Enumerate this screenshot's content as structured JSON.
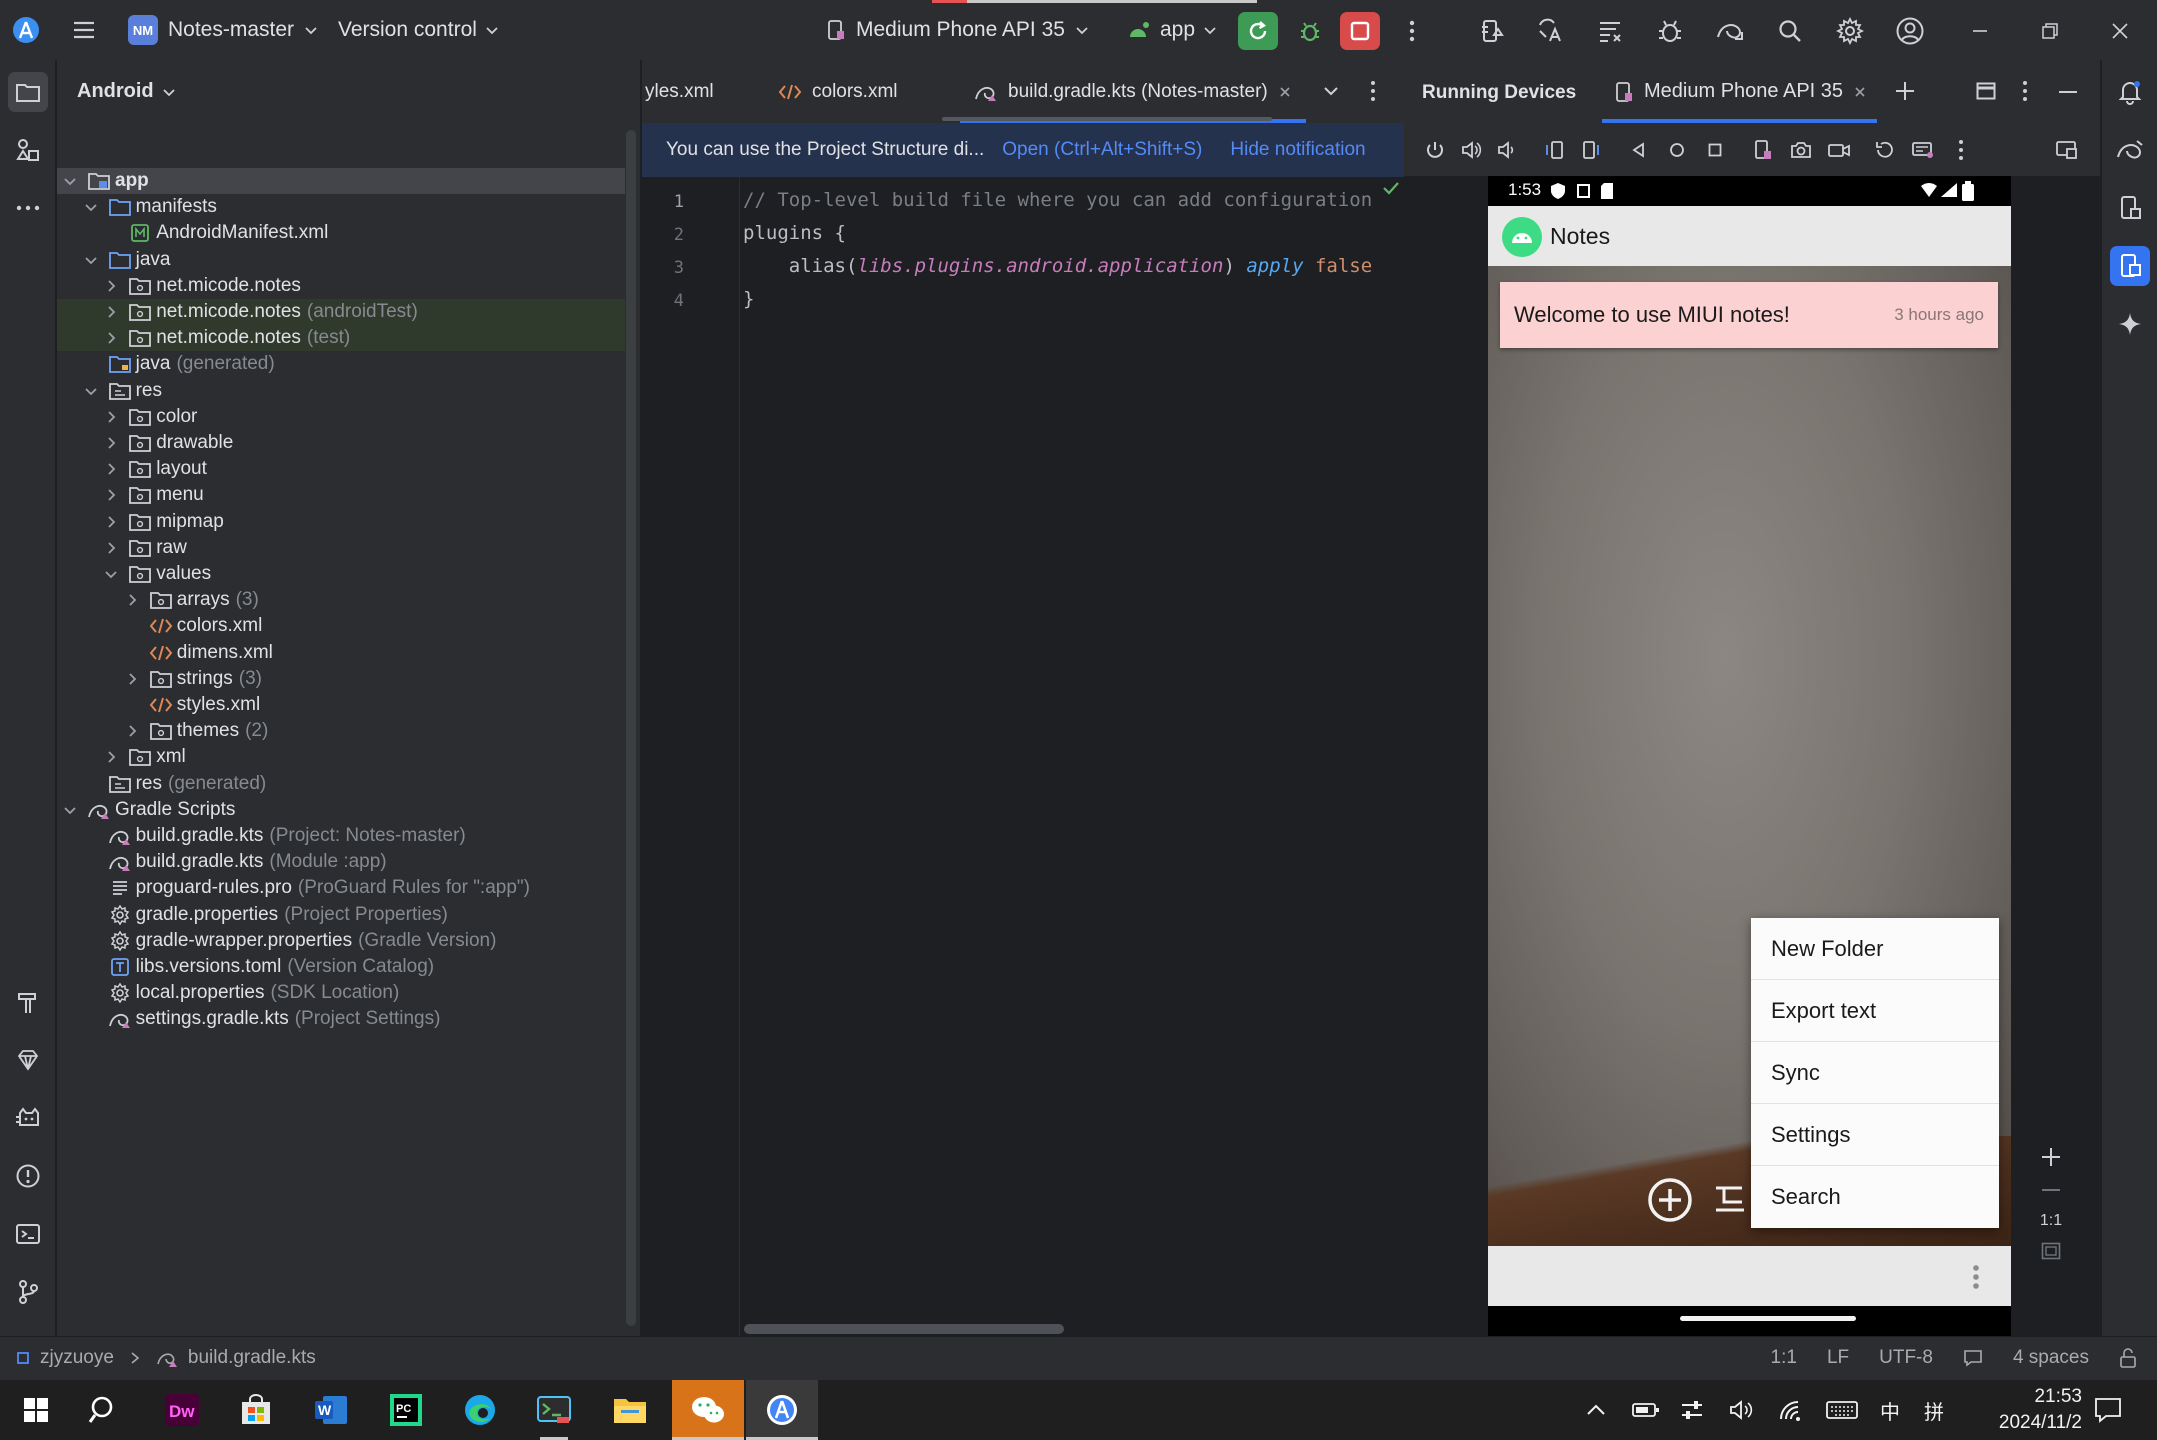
{
  "titlebar": {
    "project_badge": "NM",
    "project_name": "Notes-master",
    "vcs": "Version control",
    "device": "Medium Phone API 35",
    "run_config": "app"
  },
  "project_panel": {
    "view": "Android",
    "tree": [
      {
        "label": "app",
        "muted": "",
        "depth": 0,
        "chev": "down",
        "icon": "module-folder",
        "selected": true,
        "bold": true
      },
      {
        "label": "manifests",
        "muted": "",
        "depth": 1,
        "chev": "down",
        "icon": "folder"
      },
      {
        "label": "AndroidManifest.xml",
        "muted": "",
        "depth": 2,
        "chev": "none",
        "icon": "manifest"
      },
      {
        "label": "java",
        "muted": "",
        "depth": 1,
        "chev": "down",
        "icon": "folder"
      },
      {
        "label": "net.micode.notes",
        "muted": "",
        "depth": 2,
        "chev": "right",
        "icon": "package"
      },
      {
        "label": "net.micode.notes",
        "muted": "(androidTest)",
        "depth": 2,
        "chev": "right",
        "icon": "package",
        "test": true
      },
      {
        "label": "net.micode.notes",
        "muted": "(test)",
        "depth": 2,
        "chev": "right",
        "icon": "package",
        "test": true
      },
      {
        "label": "java",
        "muted": "(generated)",
        "depth": 1,
        "chev": "none",
        "icon": "gen-folder"
      },
      {
        "label": "res",
        "muted": "",
        "depth": 1,
        "chev": "down",
        "icon": "res-folder"
      },
      {
        "label": "color",
        "muted": "",
        "depth": 2,
        "chev": "right",
        "icon": "package"
      },
      {
        "label": "drawable",
        "muted": "",
        "depth": 2,
        "chev": "right",
        "icon": "package"
      },
      {
        "label": "layout",
        "muted": "",
        "depth": 2,
        "chev": "right",
        "icon": "package"
      },
      {
        "label": "menu",
        "muted": "",
        "depth": 2,
        "chev": "right",
        "icon": "package"
      },
      {
        "label": "mipmap",
        "muted": "",
        "depth": 2,
        "chev": "right",
        "icon": "package"
      },
      {
        "label": "raw",
        "muted": "",
        "depth": 2,
        "chev": "right",
        "icon": "package"
      },
      {
        "label": "values",
        "muted": "",
        "depth": 2,
        "chev": "down",
        "icon": "package"
      },
      {
        "label": "arrays",
        "muted": "(3)",
        "depth": 3,
        "chev": "right",
        "icon": "package"
      },
      {
        "label": "colors.xml",
        "muted": "",
        "depth": 3,
        "chev": "none",
        "icon": "xml"
      },
      {
        "label": "dimens.xml",
        "muted": "",
        "depth": 3,
        "chev": "none",
        "icon": "xml"
      },
      {
        "label": "strings",
        "muted": "(3)",
        "depth": 3,
        "chev": "right",
        "icon": "package"
      },
      {
        "label": "styles.xml",
        "muted": "",
        "depth": 3,
        "chev": "none",
        "icon": "xml"
      },
      {
        "label": "themes",
        "muted": "(2)",
        "depth": 3,
        "chev": "right",
        "icon": "package"
      },
      {
        "label": "xml",
        "muted": "",
        "depth": 2,
        "chev": "right",
        "icon": "package"
      },
      {
        "label": "res",
        "muted": "(generated)",
        "depth": 1,
        "chev": "none",
        "icon": "res-folder"
      },
      {
        "label": "Gradle Scripts",
        "muted": "",
        "depth": 0,
        "chev": "down",
        "icon": "gradle"
      },
      {
        "label": "build.gradle.kts",
        "muted": "(Project: Notes-master)",
        "depth": 1,
        "chev": "none",
        "icon": "gradle"
      },
      {
        "label": "build.gradle.kts",
        "muted": "(Module :app)",
        "depth": 1,
        "chev": "none",
        "icon": "gradle"
      },
      {
        "label": "proguard-rules.pro",
        "muted": "(ProGuard Rules for \":app\")",
        "depth": 1,
        "chev": "none",
        "icon": "text"
      },
      {
        "label": "gradle.properties",
        "muted": "(Project Properties)",
        "depth": 1,
        "chev": "none",
        "icon": "gear"
      },
      {
        "label": "gradle-wrapper.properties",
        "muted": "(Gradle Version)",
        "depth": 1,
        "chev": "none",
        "icon": "gear"
      },
      {
        "label": "libs.versions.toml",
        "muted": "(Version Catalog)",
        "depth": 1,
        "chev": "none",
        "icon": "toml"
      },
      {
        "label": "local.properties",
        "muted": "(SDK Location)",
        "depth": 1,
        "chev": "none",
        "icon": "gear"
      },
      {
        "label": "settings.gradle.kts",
        "muted": "(Project Settings)",
        "depth": 1,
        "chev": "none",
        "icon": "gradle"
      }
    ]
  },
  "editor": {
    "tabs": [
      {
        "label": "yles.xml",
        "icon": "none",
        "active": false
      },
      {
        "label": "colors.xml",
        "icon": "xml",
        "active": false
      },
      {
        "label": "build.gradle.kts (Notes-master)",
        "icon": "gradle",
        "active": true
      }
    ],
    "notification": {
      "text": "You can use the Project Structure di...",
      "open_link": "Open (Ctrl+Alt+Shift+S)",
      "hide_link": "Hide notification"
    },
    "line_numbers": [
      "1",
      "2",
      "3",
      "4"
    ],
    "code": {
      "line1": "// Top-level build file where you can add configuration",
      "line2": "plugins {",
      "line3_indent": "    alias(",
      "line3_ref": "libs.plugins.android.application",
      "line3_close": ") ",
      "line3_apply": "apply",
      "line3_false": " false",
      "line4": "}"
    }
  },
  "devices": {
    "title": "Running Devices",
    "tab": "Medium Phone API 35",
    "zoom_label": "1:1",
    "phone": {
      "time": "1:53",
      "app_title": "Notes",
      "note_text": "Welcome to use MIUI notes!",
      "note_time": "3 hours ago",
      "menu": [
        "New Folder",
        "Export text",
        "Sync",
        "Settings",
        "Search"
      ]
    }
  },
  "statusbar": {
    "breadcrumb_root": "zjyzuoye",
    "breadcrumb_file": "build.gradle.kts",
    "position": "1:1",
    "line_sep": "LF",
    "encoding": "UTF-8",
    "indent": "4 spaces"
  },
  "taskbar": {
    "ime_lang": "中",
    "ime_mode": "拼",
    "time": "21:53",
    "date": "2024/11/2",
    "apps": [
      "start",
      "search",
      "dreamweaver",
      "store",
      "word",
      "pycharm",
      "edge",
      "terminal",
      "explorer",
      "wechat",
      "android-studio"
    ]
  },
  "colors": {
    "accent": "#3574f0",
    "run_green": "#3d9b56",
    "stop_red": "#d84b4b",
    "note_pink": "#fcd1d1"
  }
}
